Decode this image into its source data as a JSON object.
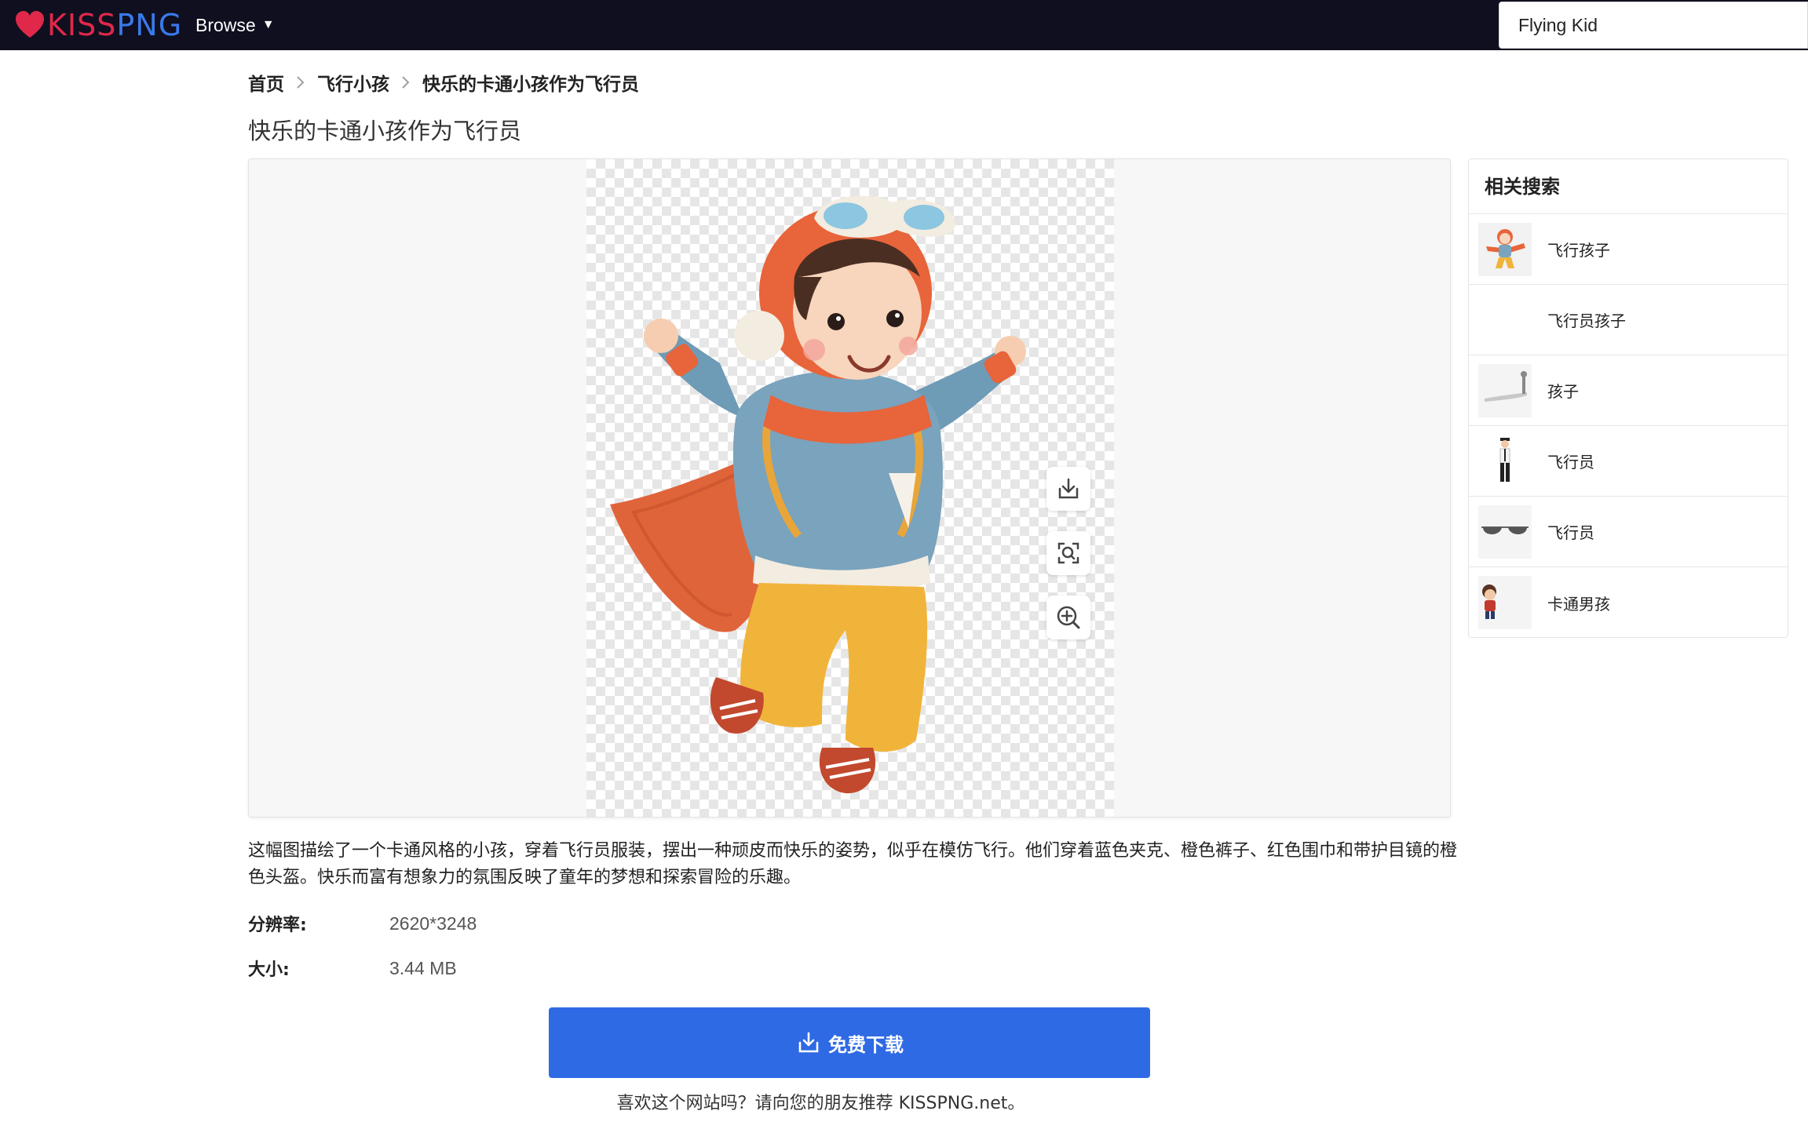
{
  "brand": {
    "kiss": "KISS",
    "png": "PNG"
  },
  "nav": {
    "browse_label": "Browse",
    "browse_caret": "▼"
  },
  "search": {
    "value": "Flying Kid"
  },
  "breadcrumb": {
    "items": [
      "首页",
      "飞行小孩",
      "快乐的卡通小孩作为飞行员"
    ],
    "separator": ">"
  },
  "page_title": "快乐的卡通小孩作为飞行员",
  "preview": {
    "tools": [
      "download-icon",
      "image-search-icon",
      "zoom-in-icon"
    ]
  },
  "related": {
    "title": "相关搜索",
    "items": [
      {
        "label": "飞行孩子",
        "icon": "flying-kid-thumbnail"
      },
      {
        "label": "飞行员孩子",
        "icon": ""
      },
      {
        "label": "孩子",
        "icon": "kid-shadow-thumbnail"
      },
      {
        "label": "飞行员",
        "icon": "pilot-figure-thumbnail"
      },
      {
        "label": "飞行员",
        "icon": "aviator-sunglasses-thumbnail"
      },
      {
        "label": "卡通男孩",
        "icon": "cartoon-boy-thumbnail"
      }
    ]
  },
  "description": "这幅图描绘了一个卡通风格的小孩，穿着飞行员服装，摆出一种顽皮而快乐的姿势，似乎在模仿飞行。他们穿着蓝色夹克、橙色裤子、红色围巾和带护目镜的橙色头盔。快乐而富有想象力的氛围反映了童年的梦想和探索冒险的乐趣。",
  "meta": {
    "resolution_label": "分辨率:",
    "resolution_value": "2620*3248",
    "size_label": "大小:",
    "size_value": "3.44 MB"
  },
  "download": {
    "label": "免费下载"
  },
  "footer": {
    "note": "喜欢这个网站吗？请向您的朋友推荐 KISSPNG.net。"
  },
  "colors": {
    "topbar": "#0f0f1f",
    "brand_red": "#e0284a",
    "brand_blue": "#3a79ea",
    "download_button": "#2f6ae5"
  }
}
